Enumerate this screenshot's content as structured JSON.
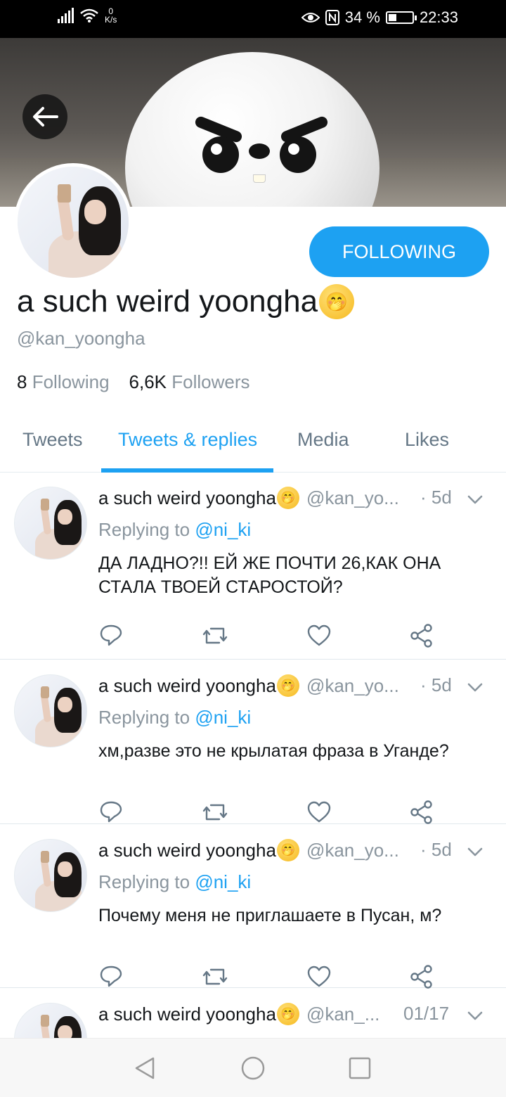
{
  "status_bar": {
    "network_speed_value": "0",
    "network_speed_unit": "K/s",
    "battery_percent": "34 %",
    "battery_level": 0.34,
    "time": "22:33",
    "icons": [
      "signal-icon",
      "wifi-icon",
      "eye-icon",
      "nfc-icon",
      "battery-icon"
    ]
  },
  "header": {
    "back_icon": "back-arrow-icon"
  },
  "profile": {
    "display_name": "a such weird yoongha",
    "name_emoji": "🤭",
    "handle": "@kan_yoongha",
    "following_count": "8",
    "following_label": "Following",
    "followers_count": "6,6K",
    "followers_label": "Followers",
    "follow_button_label": "FOLLOWING"
  },
  "tabs": [
    {
      "label": "Tweets",
      "active": false
    },
    {
      "label": "Tweets & replies",
      "active": true
    },
    {
      "label": "Media",
      "active": false
    },
    {
      "label": "Likes",
      "active": false
    }
  ],
  "tweets": [
    {
      "name": "a such weird yoongha",
      "emoji": "🤭",
      "handle": "@kan_yo...",
      "time": "· 5d",
      "replying_prefix": "Replying to",
      "replying_to": "@ni_ki",
      "text": "ДА ЛАДНО?!! ЕЙ ЖЕ ПОЧТИ 26,КАК ОНА СТАЛА ТВОЕЙ СТАРОСТОЙ?"
    },
    {
      "name": "a such weird yoongha",
      "emoji": "🤭",
      "handle": "@kan_yo...",
      "time": "· 5d",
      "replying_prefix": "Replying to",
      "replying_to": "@ni_ki",
      "text": "хм,разве это не крылатая фраза в Уганде?"
    },
    {
      "name": "a such weird yoongha",
      "emoji": "🤭",
      "handle": "@kan_yo...",
      "time": "· 5d",
      "replying_prefix": "Replying to",
      "replying_to": "@ni_ki",
      "text": "Почему меня не приглашаете в Пусан, м?"
    },
    {
      "name": "a such weird yoongha",
      "emoji": "🤭",
      "handle": "@kan_...",
      "time": "01/17",
      "replying_prefix": "",
      "replying_to": "",
      "text": ""
    }
  ],
  "tweet_action_icons": [
    "reply-icon",
    "retweet-icon",
    "like-icon",
    "share-icon"
  ],
  "navigation_bar": [
    "nav-back-icon",
    "nav-home-icon",
    "nav-recents-icon"
  ]
}
